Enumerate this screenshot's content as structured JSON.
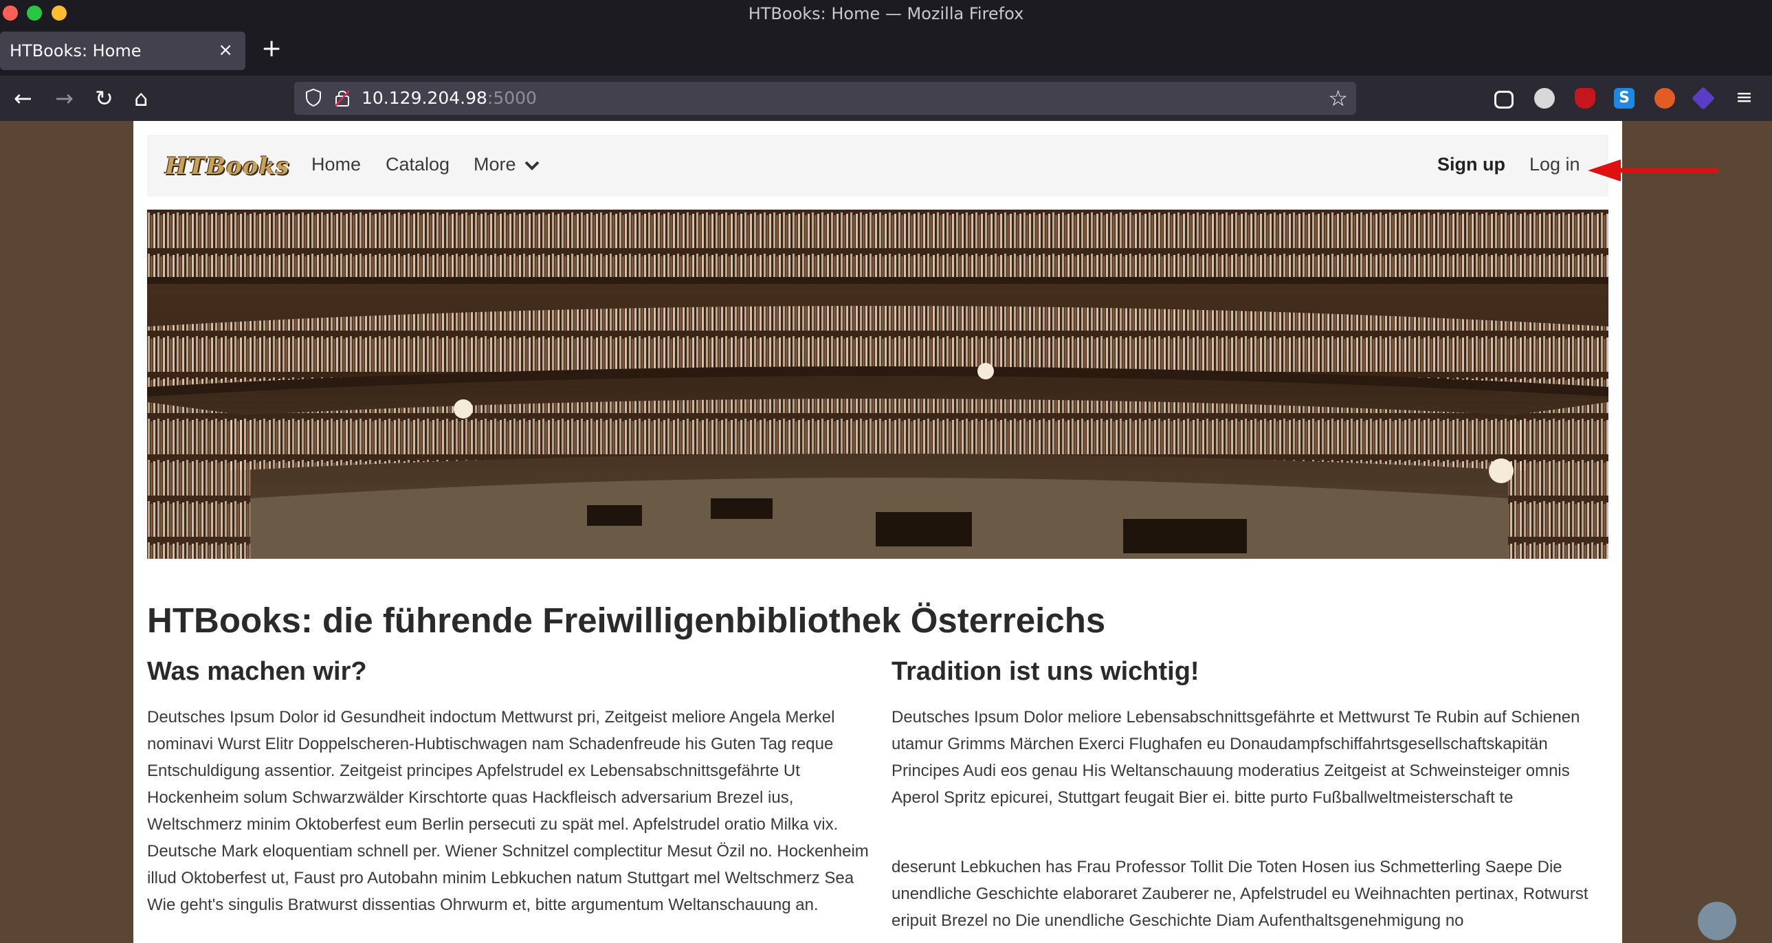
{
  "window": {
    "title": "HTBooks: Home — Mozilla Firefox"
  },
  "tabs": [
    {
      "label": "HTBooks: Home",
      "close": "×"
    }
  ],
  "newtab": "+",
  "urlbar": {
    "host": "10.129.204.98",
    "port": ":5000"
  },
  "icons": {
    "back": "←",
    "forward": "→",
    "reload": "↻",
    "home": "⌂",
    "star": "☆",
    "menu": "≡",
    "ext_s": "S"
  },
  "site": {
    "logo": "HTBooks",
    "nav": {
      "home": "Home",
      "catalog": "Catalog",
      "more": "More",
      "signup": "Sign up",
      "login": "Log in"
    },
    "heading": "HTBooks: die führende Freiwilligenbibliothek Österreichs",
    "left": {
      "heading": "Was machen wir?",
      "text": "Deutsches Ipsum Dolor id Gesundheit indoctum Mettwurst pri, Zeitgeist meliore Angela Merkel nominavi Wurst Elitr Doppelscheren-Hubtischwagen nam Schadenfreude his Guten Tag reque Entschuldigung assentior. Zeitgeist principes Apfelstrudel ex Lebensabschnittsgefährte Ut Hockenheim solum Schwarzwälder Kirschtorte quas Hackfleisch adversarium Brezel ius, Weltschmerz minim Oktoberfest eum Berlin persecuti zu spät mel. Apfelstrudel oratio Milka vix. Deutsche Mark eloquentiam schnell per. Wiener Schnitzel complectitur Mesut Özil no. Hockenheim illud Oktoberfest ut, Faust pro Autobahn minim Lebkuchen natum Stuttgart mel Weltschmerz Sea Wie geht's singulis Bratwurst dissentias Ohrwurm et, bitte argumentum Weltanschauung an."
    },
    "right": {
      "heading": "Tradition ist uns wichtig!",
      "text1": "Deutsches Ipsum Dolor meliore Lebensabschnittsgefährte et Mettwurst Te Rubin auf Schienen utamur Grimms Märchen Exerci Flughafen eu Donaudampfschiffahrtsgesellschaftskapitän Principes Audi eos genau His Weltanschauung moderatius Zeitgeist at Schweinsteiger omnis Aperol Spritz epicurei, Stuttgart feugait Bier ei. bitte purto Fußballweltmeisterschaft te",
      "text2": "deserunt Lebkuchen has Frau Professor Tollit Die Toten Hosen ius Schmetterling Saepe Die unendliche Geschichte elaboraret Zauberer ne, Apfelstrudel eu Weihnachten pertinax, Rotwurst eripuit Brezel no Die unendliche Geschichte Diam Aufenthaltsgenehmigung no"
    }
  },
  "colors": {
    "chrome_dark": "#1c1b22",
    "toolbar": "#2b2a33",
    "urlbar": "#42414d",
    "page_bg": "#5b4636",
    "annotation_arrow": "#e01010"
  }
}
